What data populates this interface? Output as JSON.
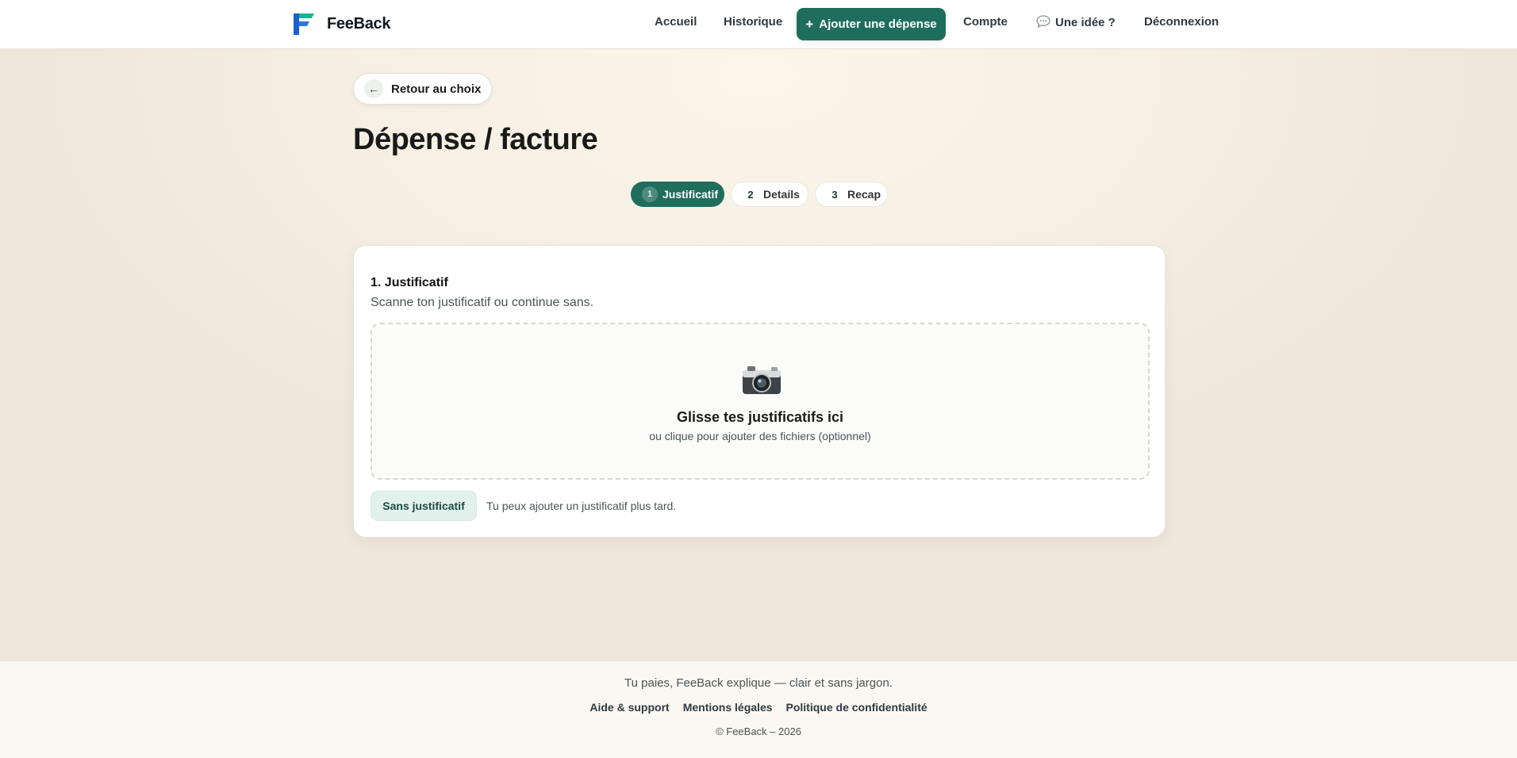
{
  "header": {
    "brand": "FeeBack",
    "nav": {
      "home": "Accueil",
      "history": "Historique",
      "add_expense": "Ajouter une dépense",
      "add_expense_prefix": "+",
      "account": "Compte",
      "idea": "Une idée ?",
      "logout": "Déconnexion"
    }
  },
  "back": {
    "arrow": "←",
    "label": "Retour au choix"
  },
  "page": {
    "title": "Dépense / facture"
  },
  "stepper": [
    {
      "number": "1",
      "label": "Justificatif",
      "active": true
    },
    {
      "number": "2",
      "label": "Details",
      "active": false
    },
    {
      "number": "3",
      "label": "Recap",
      "active": false
    }
  ],
  "card": {
    "title": "1. Justificatif",
    "subtitle": "Scanne ton justificatif ou continue sans.",
    "dropzone": {
      "icon": "camera-icon",
      "title": "Glisse tes justificatifs ici",
      "subtitle": "ou clique pour ajouter des fichiers (optionnel)"
    },
    "skip_button": "Sans justificatif",
    "skip_hint": "Tu peux ajouter un justificatif plus tard."
  },
  "footer": {
    "tagline": "Tu paies, FeeBack explique — clair et sans jargon.",
    "links": [
      "Aide & support",
      "Mentions légales",
      "Politique de confidentialité"
    ],
    "copyright": "© FeeBack – 2026"
  },
  "colors": {
    "accent": "#1f6d5d",
    "accent_soft": "#e3f1ec",
    "background": "#f6efe3",
    "text": "#1b1b1b"
  }
}
